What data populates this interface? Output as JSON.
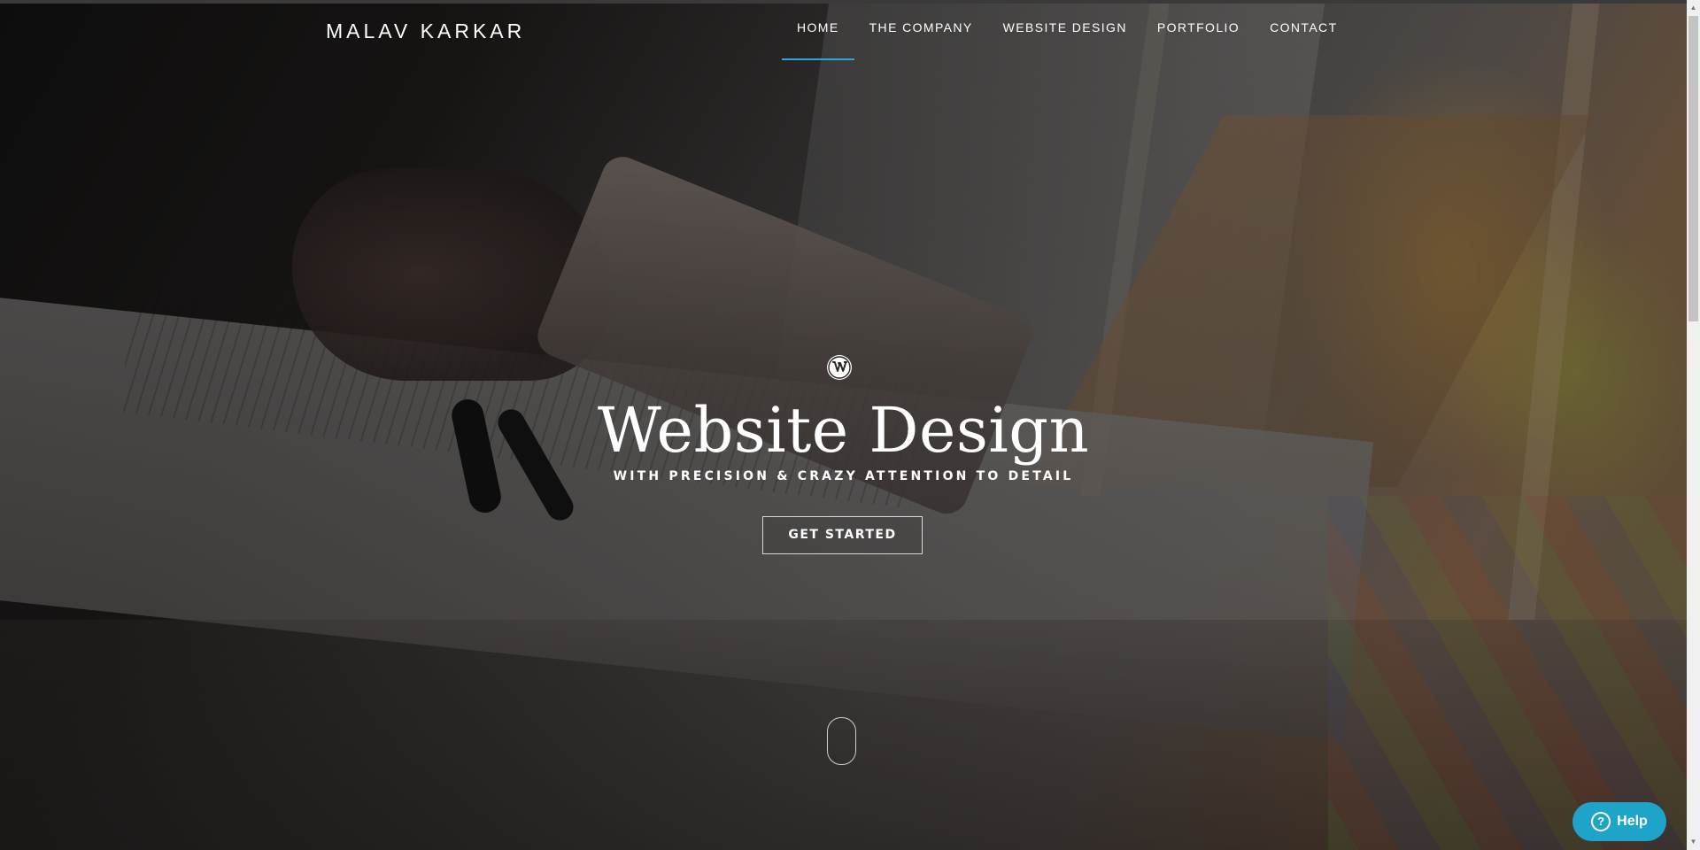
{
  "brand": {
    "name": "MALAV KARKAR"
  },
  "nav": {
    "items": [
      {
        "label": "HOME",
        "active": true
      },
      {
        "label": "THE COMPANY",
        "active": false
      },
      {
        "label": "WEBSITE DESIGN",
        "active": false
      },
      {
        "label": "PORTFOLIO",
        "active": false
      },
      {
        "label": "CONTACT",
        "active": false
      }
    ],
    "active_color": "#2aa6e0"
  },
  "hero": {
    "icon": "wordpress-icon",
    "title": "Website Design",
    "subtitle": "WITH PRECISION & CRAZY ATTENTION TO DETAIL",
    "cta_label": "GET STARTED",
    "scroll_icon": "mouse-scroll-icon"
  },
  "help": {
    "label": "Help",
    "icon": "question-icon",
    "icon_glyph": "?",
    "color": "#1ea4c9"
  },
  "scrollbar": {
    "up_glyph": "▲",
    "down_glyph": "▼"
  }
}
